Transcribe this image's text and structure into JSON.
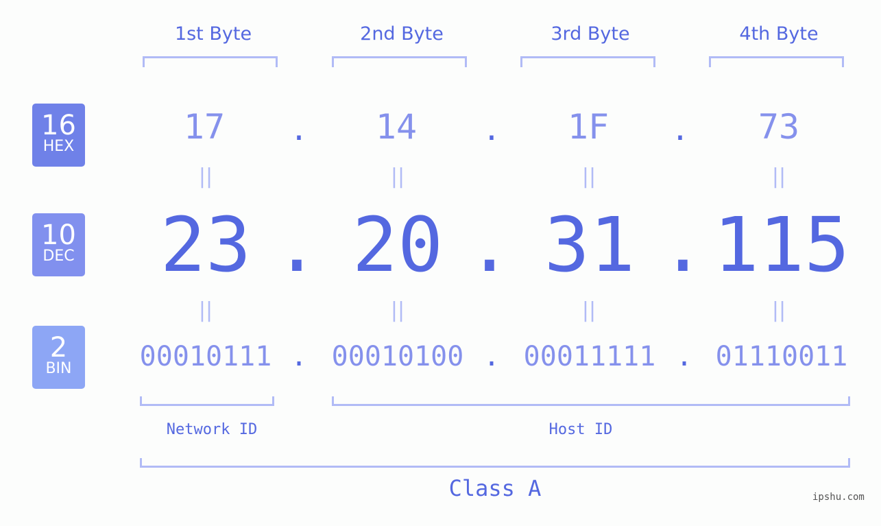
{
  "bytes": {
    "labels": [
      "1st Byte",
      "2nd Byte",
      "3rd Byte",
      "4th Byte"
    ]
  },
  "badges": {
    "hex": {
      "num": "16",
      "label": "HEX",
      "color": "#6f81e8"
    },
    "dec": {
      "num": "10",
      "label": "DEC",
      "color": "#8190ee"
    },
    "bin": {
      "num": "2",
      "label": "BIN",
      "color": "#8da6f5"
    }
  },
  "hex_values": [
    "17",
    "14",
    "1F",
    "73"
  ],
  "dec_values": [
    "23",
    "20",
    "31",
    "115"
  ],
  "bin_values": [
    "00010111",
    "00010100",
    "00011111",
    "01110011"
  ],
  "separator": ".",
  "equals": "||",
  "network_id_label": "Network ID",
  "host_id_label": "Host ID",
  "class_label": "Class A",
  "watermark": "ipshu.com",
  "colors": {
    "primary": "#5468e0",
    "light": "#8591ec",
    "bracket": "#b1bbf6"
  }
}
